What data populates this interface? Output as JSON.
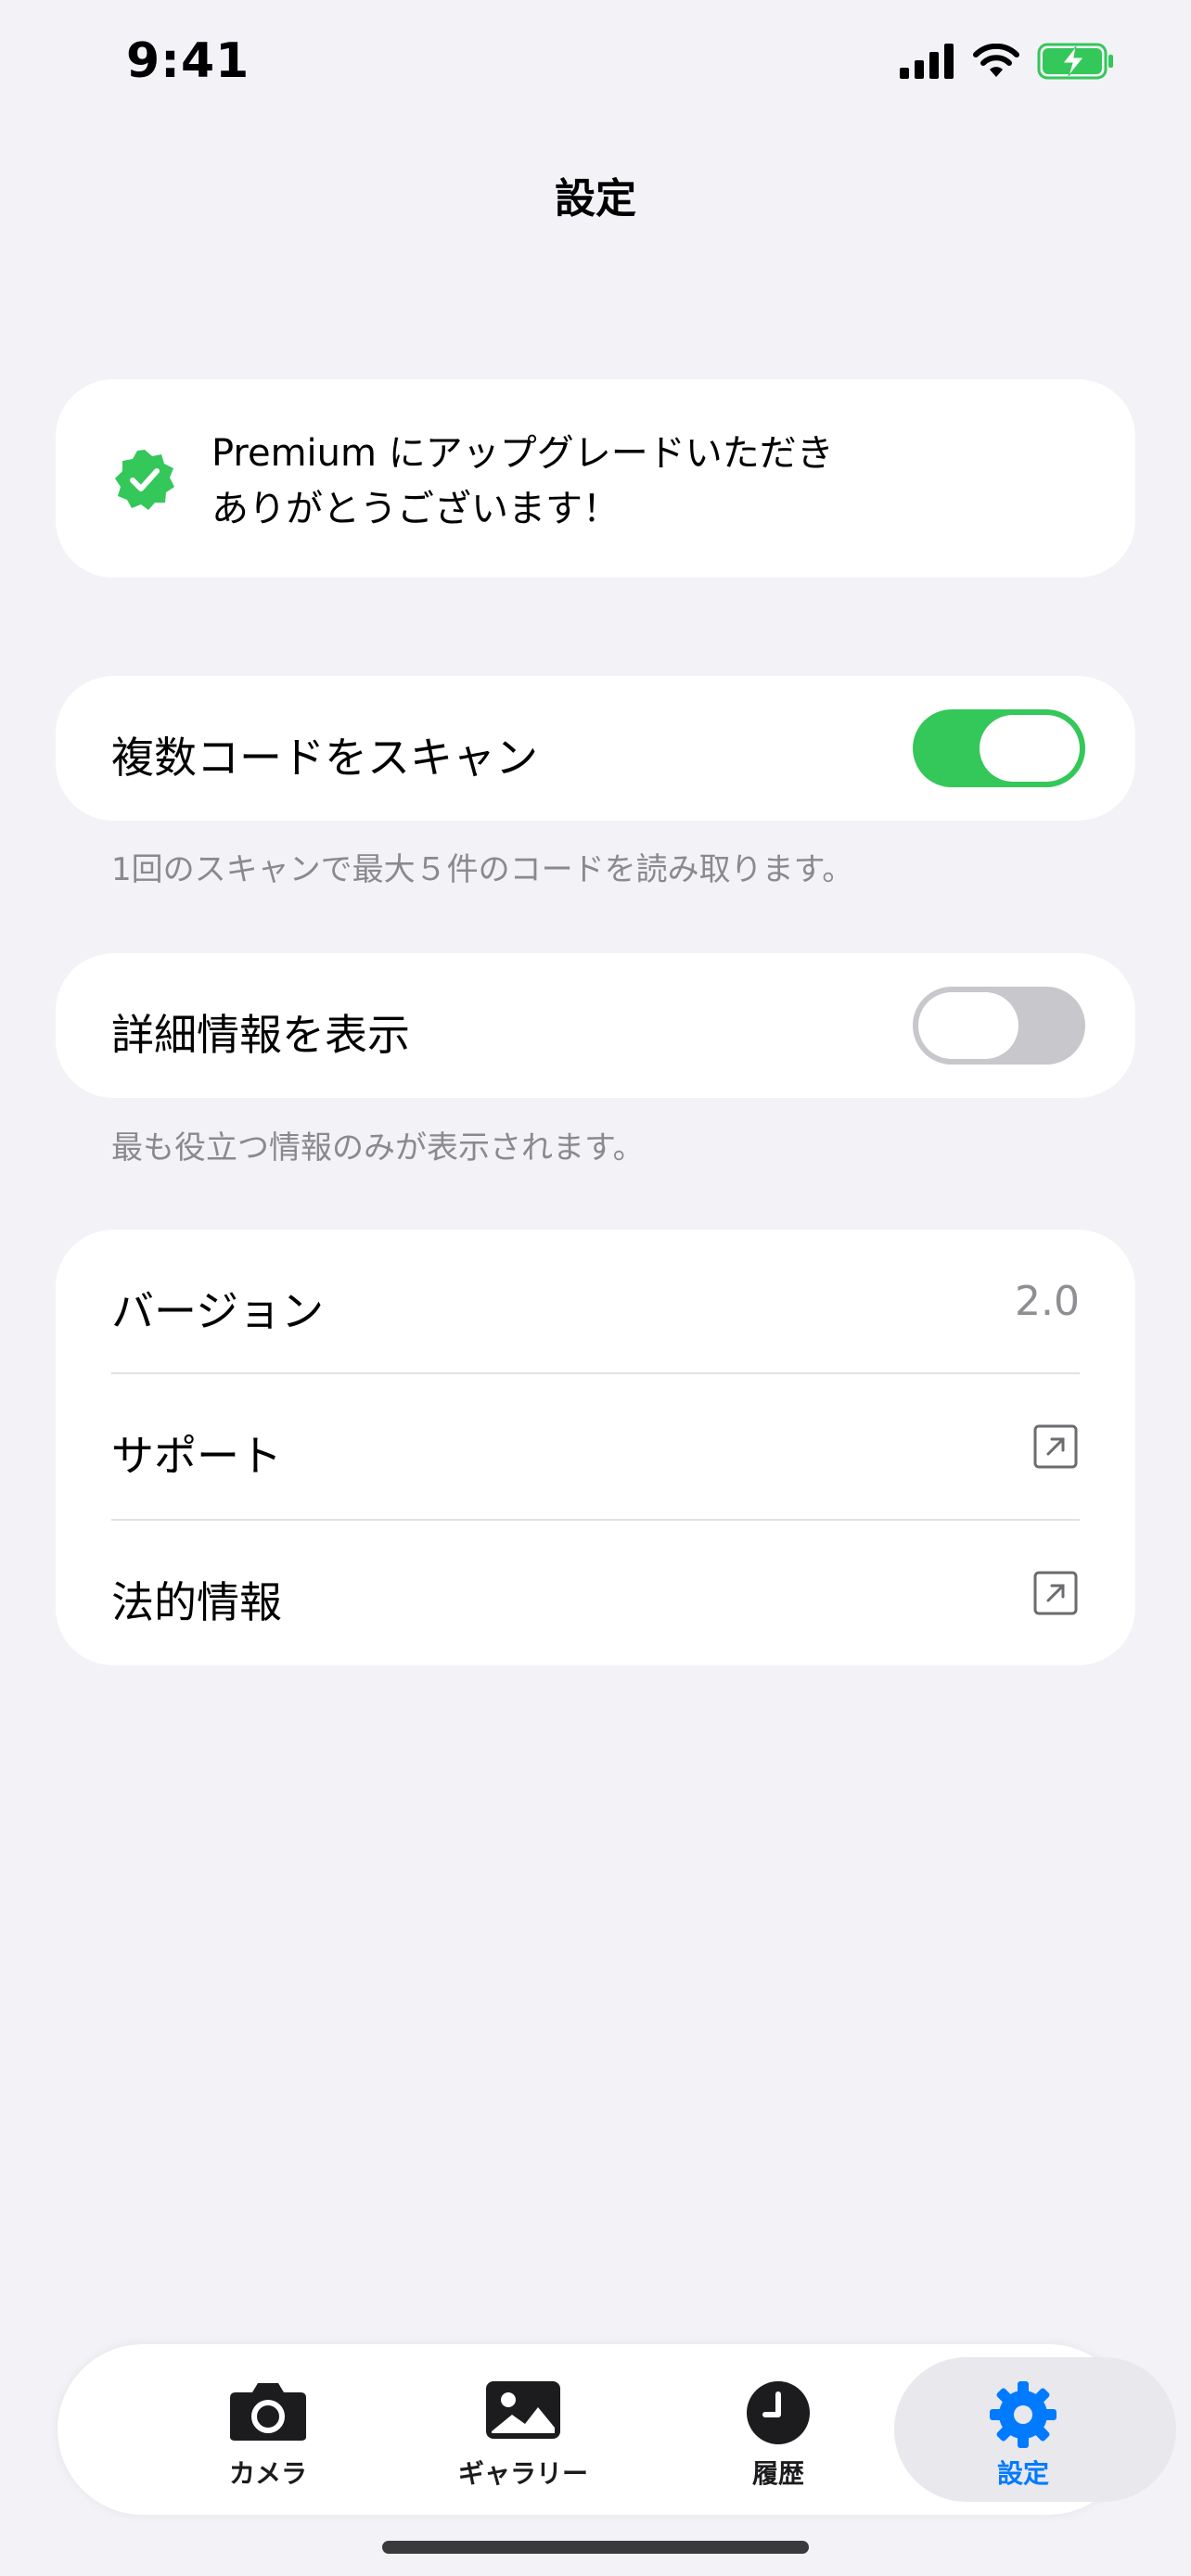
{
  "status_bar": {
    "time": "9:41"
  },
  "header": {
    "title": "設定"
  },
  "premium_banner": {
    "line1": "Premium にアップグレードいただき",
    "line2": "ありがとうございます！",
    "badge_color": "#34c759"
  },
  "settings": {
    "multi_scan": {
      "label": "複数コードをスキャン",
      "enabled": true,
      "footnote": "1回のスキャンで最大５件のコードを読み取ります。"
    },
    "details": {
      "label": "詳細情報を表示",
      "enabled": false,
      "footnote": "最も役立つ情報のみが表示されます。"
    }
  },
  "info_list": {
    "version_label": "バージョン",
    "version_value": "2.0",
    "support_label": "サポート",
    "legal_label": "法的情報"
  },
  "tabbar": {
    "tabs": [
      {
        "label": "カメラ",
        "icon": "camera-icon"
      },
      {
        "label": "ギャラリー",
        "icon": "photo-icon"
      },
      {
        "label": "履歴",
        "icon": "clock-icon"
      },
      {
        "label": "設定",
        "icon": "gear-icon",
        "active": true
      }
    ],
    "accent_color": "#007aff"
  }
}
